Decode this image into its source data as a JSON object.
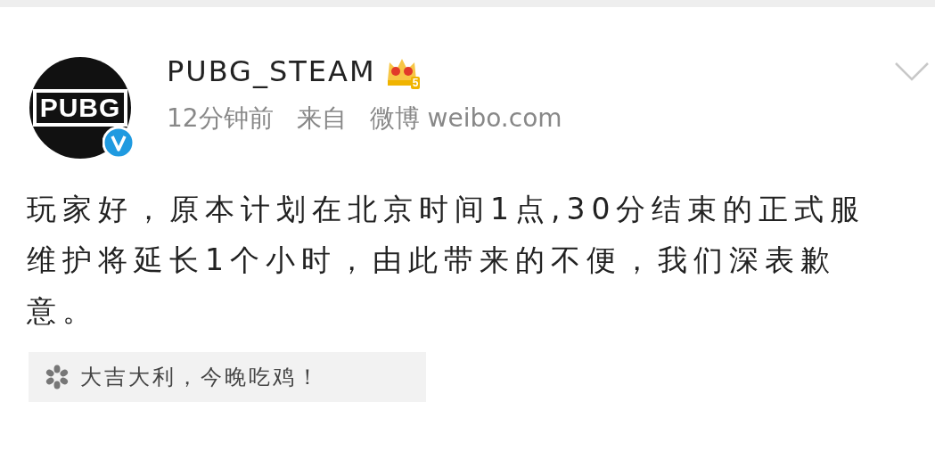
{
  "post": {
    "avatar_label": "PUBG",
    "verified": true,
    "username": "PUBG_STEAM",
    "vip_level": "5",
    "time": "12分钟前",
    "source_prefix": "来自",
    "source": "微博 weibo.com",
    "text": "玩家好，原本计划在北京时间1点,30分结束的正式服维护将延长1个小时，由此带来的不便，我们深表歉意。",
    "tag": "大吉大利，今晚吃鸡！"
  }
}
